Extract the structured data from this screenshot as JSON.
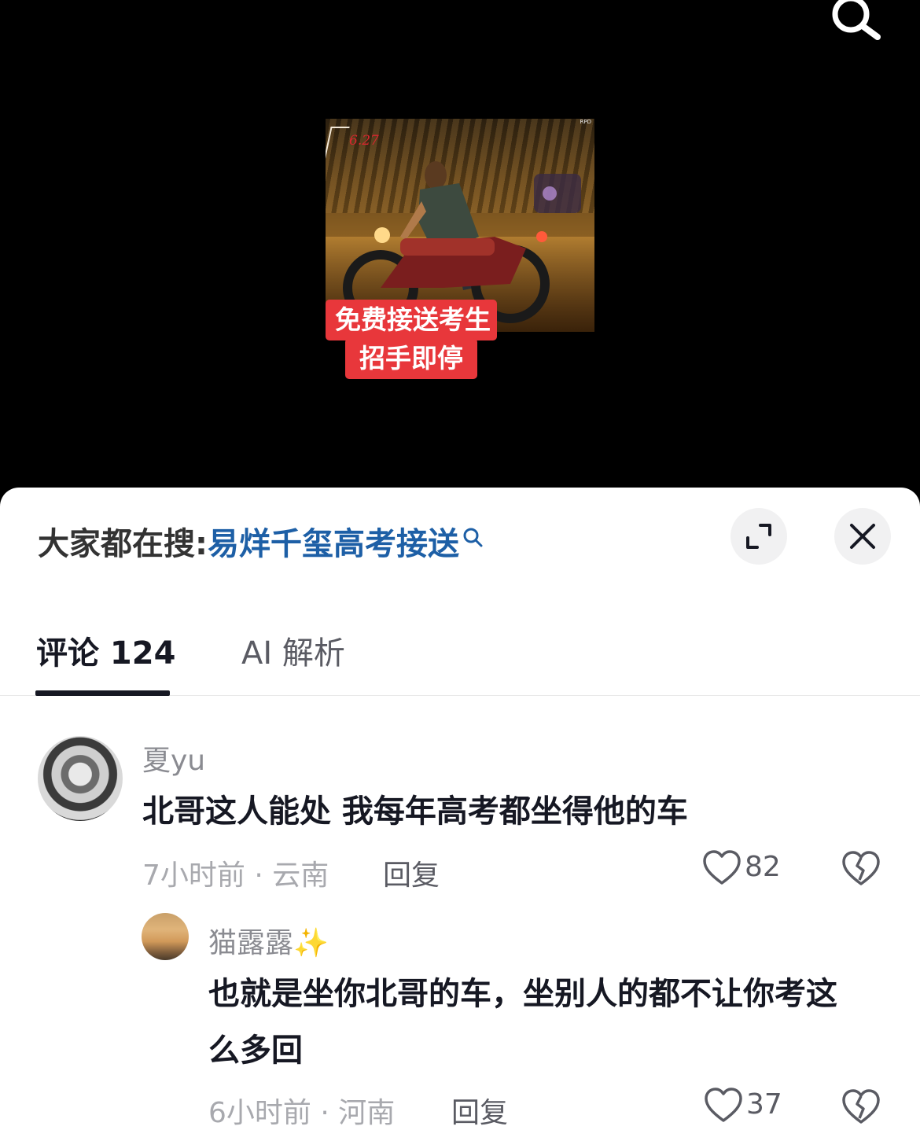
{
  "video": {
    "date_stamp": "6.27",
    "corner_mark": "RPD",
    "subtitle_line1": "免费接送考生",
    "subtitle_line2": "招手即停"
  },
  "header": {
    "hot_search_label": "大家都在搜:",
    "hot_search_term": "易烊千玺高考接送"
  },
  "tabs": [
    {
      "label": "评论 124"
    },
    {
      "label": "AI 解析"
    }
  ],
  "comments": [
    {
      "username": "夏yu",
      "text": "北哥这人能处 我每年高考都坐得他的车",
      "meta": "7小时前 · 云南",
      "reply_label": "回复",
      "likes": "82"
    },
    {
      "username": "猫露露✨",
      "text": "也就是坐你北哥的车，坐别人的都不让你考这么多回",
      "meta": "6小时前 · 河南",
      "reply_label": "回复",
      "likes": "37"
    }
  ],
  "colors": {
    "accent_link": "#1d5fa6",
    "subtitle_bg": "#e8373b",
    "text_primary": "#161823",
    "text_secondary": "#8a8b91"
  },
  "icons": [
    "search-icon",
    "expand-icon",
    "close-icon",
    "heart-icon",
    "broken-heart-icon"
  ]
}
